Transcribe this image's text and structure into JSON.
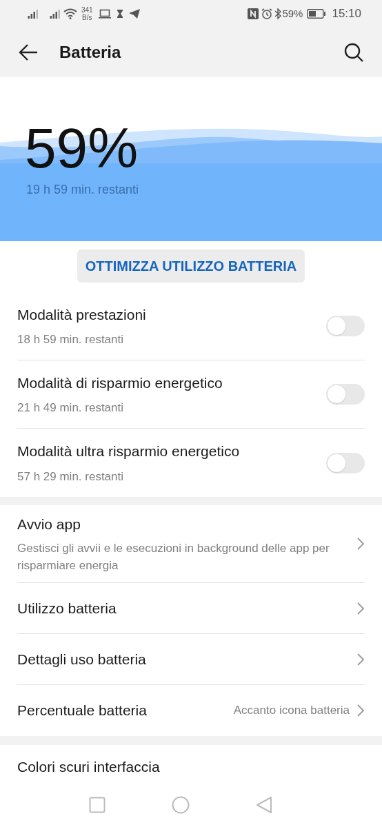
{
  "status_bar": {
    "net_speed_value": "341",
    "net_speed_unit": "B/s",
    "battery": "59%",
    "time": "15:10"
  },
  "header": {
    "title": "Batteria"
  },
  "hero": {
    "percent": "59%",
    "remaining": "19 h 59 min. restanti"
  },
  "optimize_button": "OTTIMIZZA UTILIZZO BATTERIA",
  "modes": [
    {
      "title": "Modalità prestazioni",
      "subtitle": "18 h 59 min. restanti",
      "on": false
    },
    {
      "title": "Modalità di risparmio energetico",
      "subtitle": "21 h 49 min. restanti",
      "on": false
    },
    {
      "title": "Modalità ultra risparmio energetico",
      "subtitle": "57 h 29 min. restanti",
      "on": false
    }
  ],
  "settings": [
    {
      "title": "Avvio app",
      "subtitle": "Gestisci gli avvii e le esecuzioni in background delle app per risparmiare energia"
    },
    {
      "title": "Utilizzo batteria"
    },
    {
      "title": "Dettagli uso batteria"
    },
    {
      "title": "Percentuale batteria",
      "value": "Accanto icona batteria"
    }
  ],
  "more": [
    {
      "title": "Colori scuri interfaccia"
    }
  ]
}
